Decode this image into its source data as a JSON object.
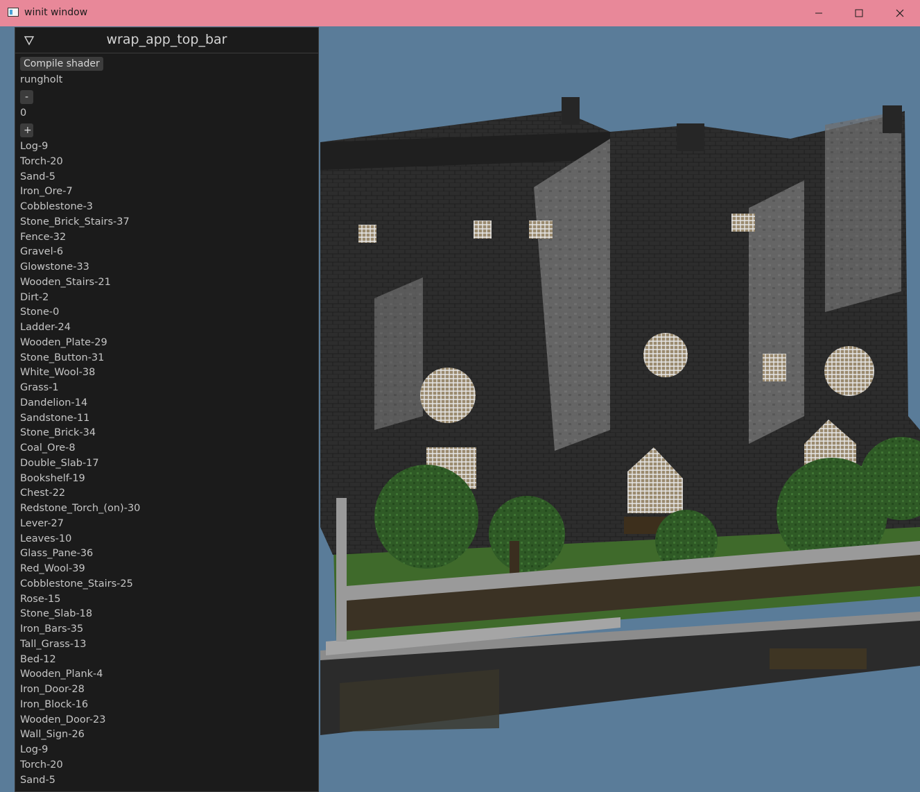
{
  "window": {
    "title": "winit window"
  },
  "panel": {
    "title": "wrap_app_top_bar",
    "compile_button": "Compile shader",
    "scene_name": "rungholt",
    "decrement_button": "-",
    "counter_value": "0",
    "increment_button": "+",
    "materials": [
      "Log-9",
      "Torch-20",
      "Sand-5",
      "Iron_Ore-7",
      "Cobblestone-3",
      "Stone_Brick_Stairs-37",
      "Fence-32",
      "Gravel-6",
      "Glowstone-33",
      "Wooden_Stairs-21",
      "Dirt-2",
      "Stone-0",
      "Ladder-24",
      "Wooden_Plate-29",
      "Stone_Button-31",
      "White_Wool-38",
      "Grass-1",
      "Dandelion-14",
      "Sandstone-11",
      "Stone_Brick-34",
      "Coal_Ore-8",
      "Double_Slab-17",
      "Bookshelf-19",
      "Chest-22",
      "Redstone_Torch_(on)-30",
      "Lever-27",
      "Leaves-10",
      "Glass_Pane-36",
      "Red_Wool-39",
      "Cobblestone_Stairs-25",
      "Rose-15",
      "Stone_Slab-18",
      "Iron_Bars-35",
      "Tall_Grass-13",
      "Bed-12",
      "Wooden_Plank-4",
      "Iron_Door-28",
      "Iron_Block-16",
      "Wooden_Door-23",
      "Wall_Sign-26",
      "Log-9",
      "Torch-20",
      "Sand-5"
    ]
  },
  "colors": {
    "titlebar": "#e88899",
    "sky": "#5a7c99",
    "panel_bg": "#1b1b1b",
    "button_bg": "#3c3c3c"
  }
}
